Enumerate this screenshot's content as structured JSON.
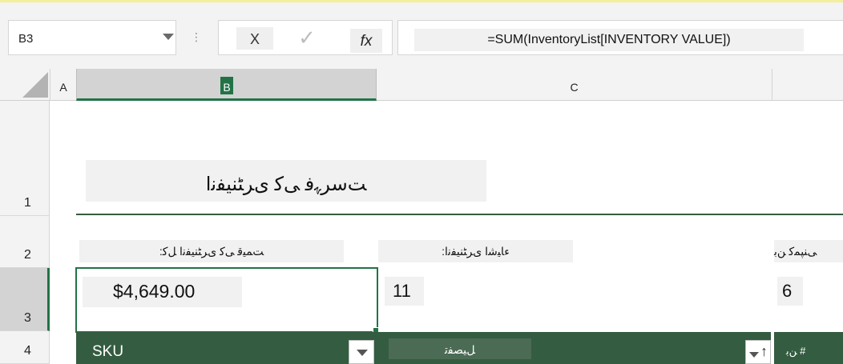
{
  "formula_bar": {
    "name_box": "B3",
    "separator": "⋮",
    "cancel_label": "X",
    "enter_label": "✓",
    "fx_label": "fx",
    "formula": "=SUM(InventoryList[INVENTORY VALUE])"
  },
  "columns": [
    "A",
    "B",
    "C"
  ],
  "rows": [
    "1",
    "2",
    "3",
    "4"
  ],
  "sheet": {
    "title": "ﺖﺳﺮﮩﻓ ﯽﮐ ﯼﺮﭩﻨﯿﻔﻧﺍ",
    "labels": [
      "ﺖﻤﯿﻗ ﯽﮐ ﯼﺮﭩﻨﯿﻔﻧﺍ ﻞﮐ:",
      "ﺀﺎﯿﺷﺍ ﯼﺮﭩﻨﯿﻔﻧﺍ:",
      "ﯽﻨﭙﻤﮐ ﻦﺑ"
    ],
    "values": [
      "$4,649.00",
      "11",
      "6"
    ]
  },
  "table_header": {
    "sku": "SKU",
    "description": "ﻞﯿﺼﻔﺗ",
    "sort_icon_glyph": "↑",
    "bin_number": "# ﻦﺑ"
  },
  "colors": {
    "accent_green": "#217346",
    "table_header_bg": "#345c40",
    "ribbon_border": "#f4ef9a"
  }
}
